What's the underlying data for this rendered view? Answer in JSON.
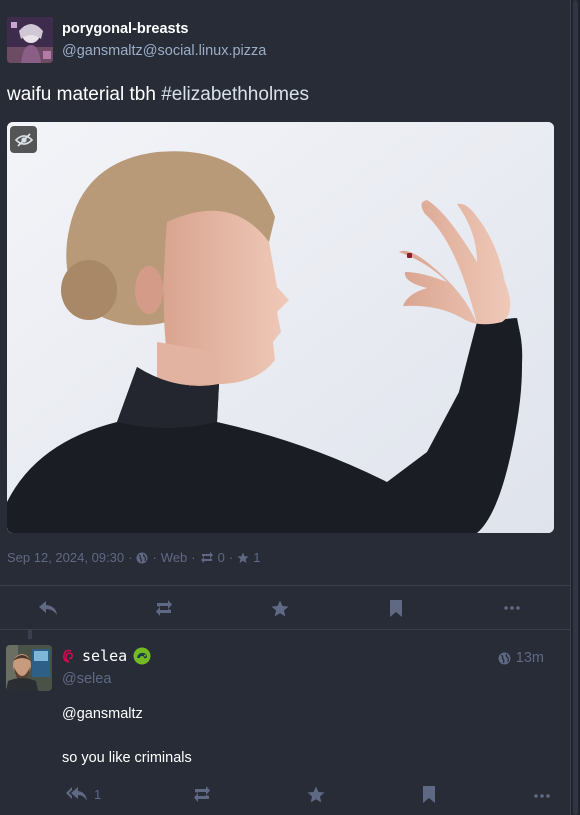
{
  "status": {
    "display_name": "porygonal-breasts",
    "acct": "@gansmaltz@social.linux.pizza",
    "content_text": "waifu material tbh ",
    "hashtag": "#elizabethholmes",
    "meta": {
      "date": "Sep 12, 2024, 09:30",
      "separator": "·",
      "visibility_icon": "globe-icon",
      "application": "Web",
      "reblogs_count": "0",
      "favourites_count": "1"
    },
    "actions": [
      "reply-icon",
      "boost-icon",
      "favourite-icon",
      "bookmark-icon",
      "more-icon"
    ]
  },
  "reply": {
    "display_name": "selea",
    "acct": "@selea",
    "time": "13m",
    "content_lines": [
      "@gansmaltz",
      "so you like criminals"
    ],
    "replies_count": "1",
    "actions": [
      "reply-all-icon",
      "boost-icon",
      "favourite-icon",
      "bookmark-icon",
      "more-icon"
    ]
  },
  "colors": {
    "background": "#282c37",
    "secondary_text": "#606984",
    "handle_text": "#9baec8",
    "debian_red": "#d70751",
    "opensuse_green": "#73ba25"
  }
}
